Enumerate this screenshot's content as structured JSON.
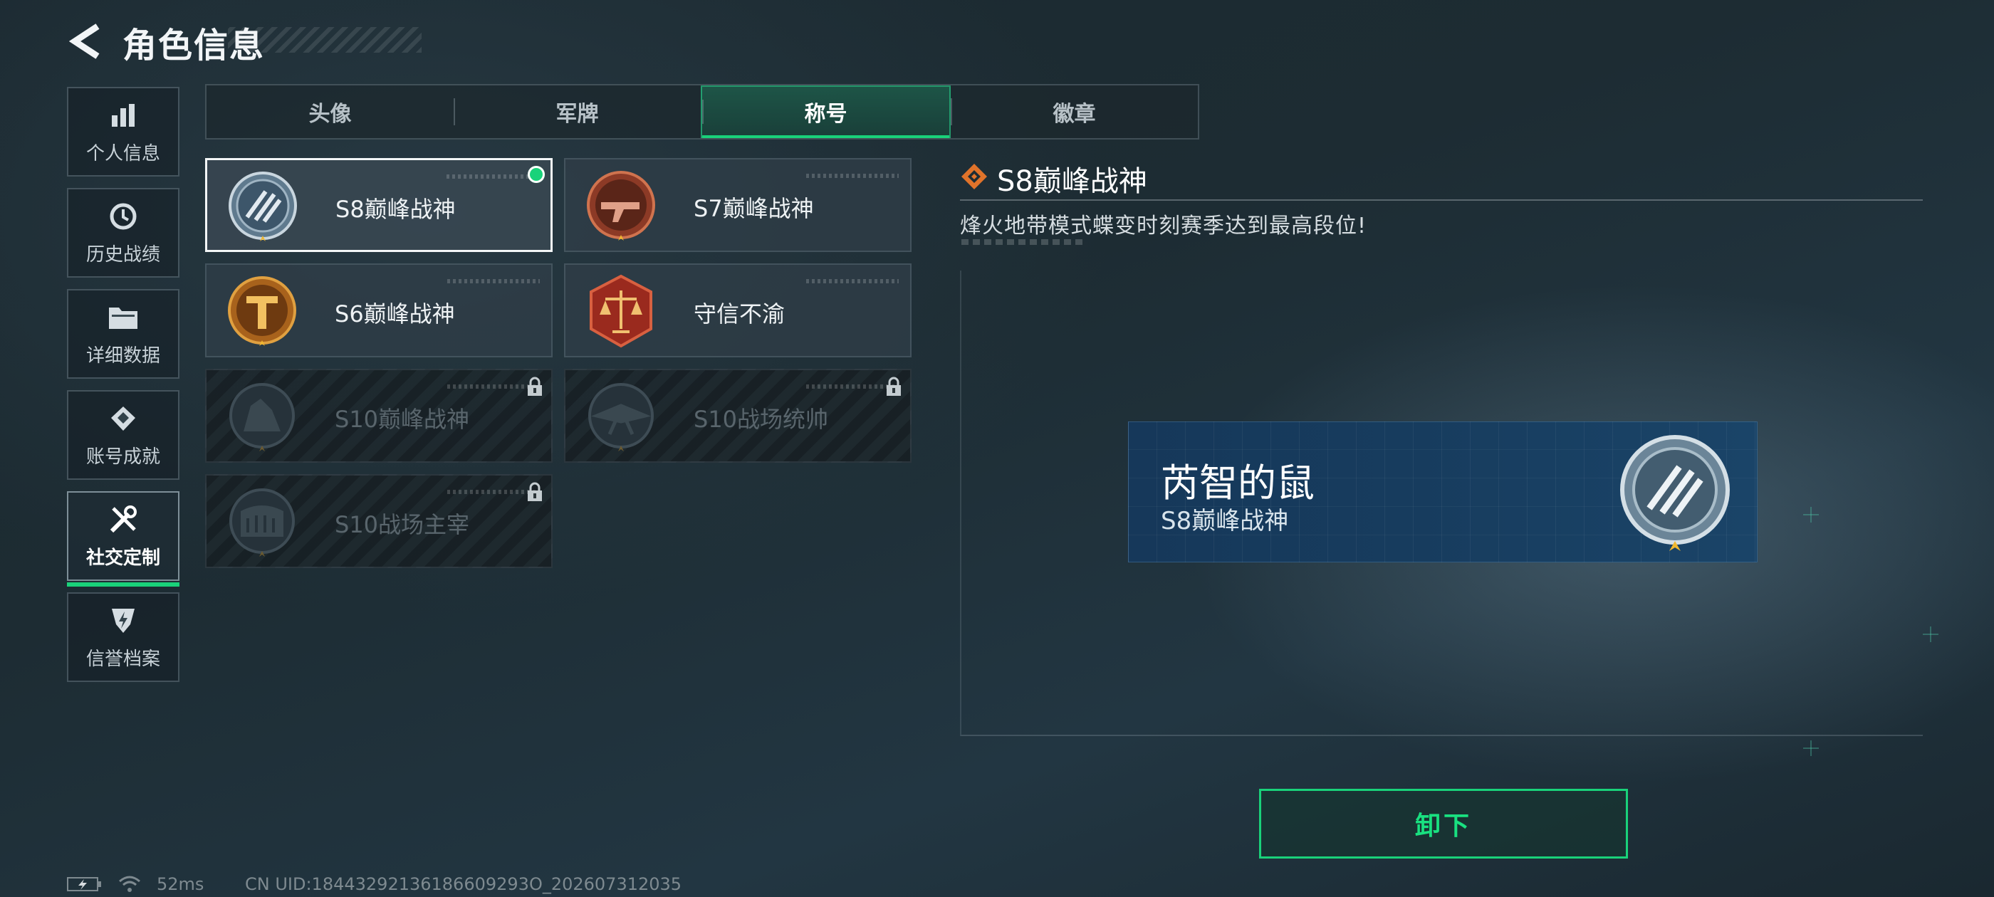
{
  "header": {
    "title": "角色信息"
  },
  "sidebar": {
    "items": [
      {
        "label": "个人信息",
        "icon": "bar-chart-icon"
      },
      {
        "label": "历史战绩",
        "icon": "history-icon"
      },
      {
        "label": "详细数据",
        "icon": "folder-icon"
      },
      {
        "label": "账号成就",
        "icon": "achievement-icon"
      },
      {
        "label": "社交定制",
        "icon": "tools-icon",
        "active": true
      },
      {
        "label": "信誉档案",
        "icon": "credit-shield-icon"
      }
    ]
  },
  "tabs": [
    {
      "label": "头像"
    },
    {
      "label": "军牌"
    },
    {
      "label": "称号",
      "active": true
    },
    {
      "label": "徽章"
    }
  ],
  "titles": [
    {
      "name": "S8巅峰战神",
      "state": "equipped"
    },
    {
      "name": "S7巅峰战神",
      "state": "unlocked"
    },
    {
      "name": "S6巅峰战神",
      "state": "unlocked"
    },
    {
      "name": "守信不渝",
      "state": "unlocked"
    },
    {
      "name": "S10巅峰战神",
      "state": "locked"
    },
    {
      "name": "S10战场统帅",
      "state": "locked"
    },
    {
      "name": "S10战场主宰",
      "state": "locked"
    }
  ],
  "detail": {
    "title": "S8巅峰战神",
    "description": "烽火地带模式蝶变时刻赛季达到最高段位!"
  },
  "preview": {
    "player_name": "芮智的鼠",
    "title": "S8巅峰战神"
  },
  "actions": {
    "unequip_label": "卸下"
  },
  "status": {
    "ping": "52ms",
    "uid": "CN UID:18443292136186609293O_202607312035"
  },
  "colors": {
    "accent": "#19d27a",
    "panel": "#303e48",
    "preview_bg": "#16385a"
  }
}
